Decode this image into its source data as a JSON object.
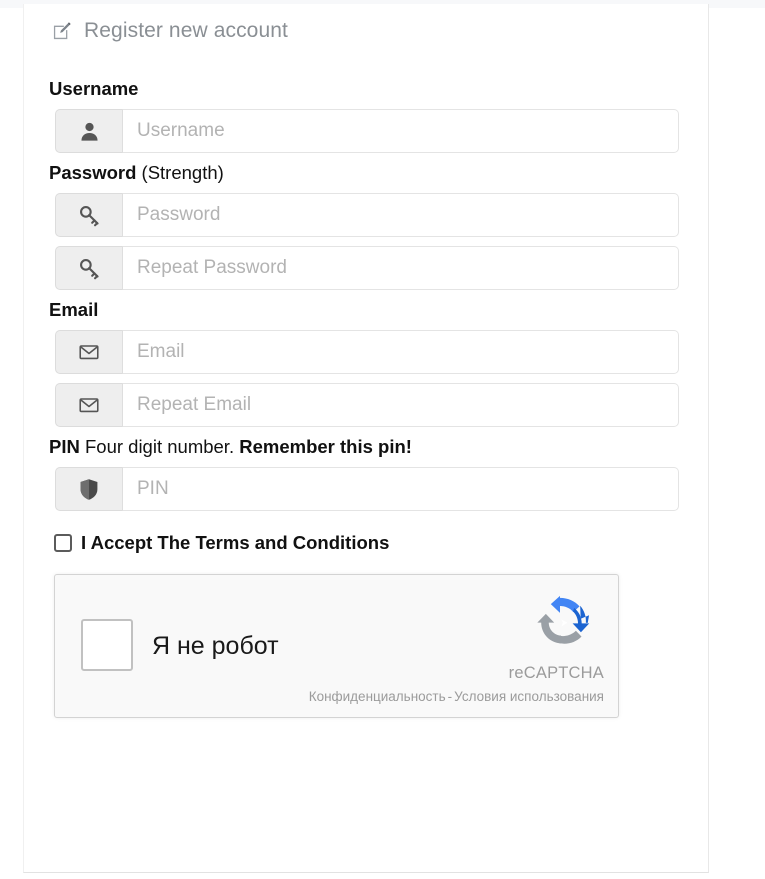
{
  "panel": {
    "title": "Register new account",
    "title_icon": "edit-square-pencil-icon"
  },
  "form": {
    "username": {
      "label": "Username",
      "icon": "user-icon",
      "placeholder": "Username",
      "value": ""
    },
    "password": {
      "label_bold": "Password",
      "label_rest": "(Strength)",
      "icon": "key-icon",
      "placeholder": "Password",
      "value": "",
      "repeat_placeholder": "Repeat Password",
      "repeat_value": "",
      "repeat_icon": "key-icon"
    },
    "email": {
      "label": "Email",
      "icon": "envelope-icon",
      "placeholder": "Email",
      "value": "",
      "repeat_placeholder": "Repeat Email",
      "repeat_value": "",
      "repeat_icon": "envelope-icon"
    },
    "pin": {
      "label_bold": "PIN",
      "label_rest": "Four digit number.",
      "label_bold2": "Remember this pin!",
      "icon": "shield-icon",
      "placeholder": "PIN",
      "value": ""
    },
    "terms": {
      "label": "I Accept The Terms and Conditions",
      "checked": false
    }
  },
  "recaptcha": {
    "checkbox_label": "Я не робот",
    "brand": "reCAPTCHA",
    "logo_icon": "recaptcha-logo-icon",
    "privacy_link": "Конфиденциальность",
    "separator": "-",
    "terms_link": "Условия использования",
    "checked": false
  },
  "colors": {
    "title_gray": "#8a8f94",
    "addon_bg": "#eeeeee",
    "placeholder": "#b3b3b3",
    "recaptcha_bg": "#f9f9f9",
    "recaptcha_blue": "#1c64d1",
    "recaptcha_blue_light": "#4285f4",
    "recaptcha_gray": "#9aa0a6"
  }
}
